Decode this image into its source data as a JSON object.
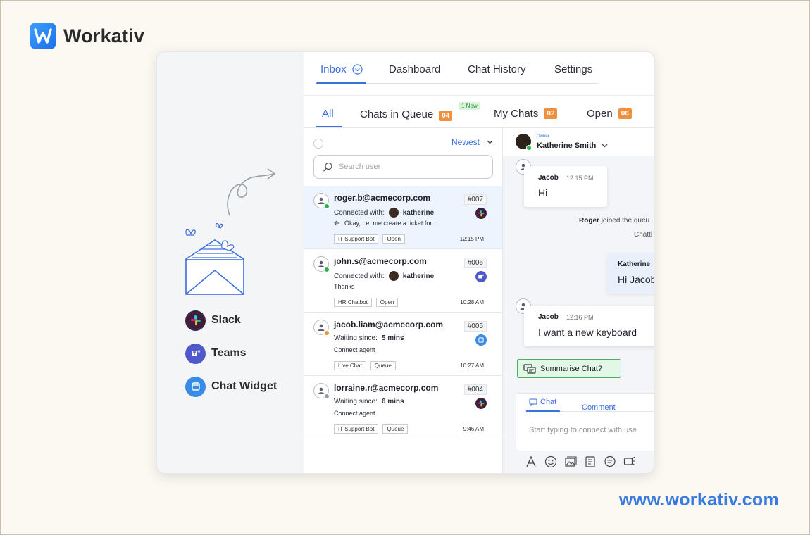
{
  "brand": {
    "name": "Workativ",
    "url": "www.workativ.com"
  },
  "channels": [
    {
      "label": "Slack",
      "icon": "slack-icon"
    },
    {
      "label": "Teams",
      "icon": "teams-icon"
    },
    {
      "label": "Chat Widget",
      "icon": "chat-widget-icon"
    }
  ],
  "nav": {
    "inbox": "Inbox",
    "dashboard": "Dashboard",
    "chat_history": "Chat History",
    "settings": "Settings"
  },
  "subtabs": {
    "all": "All",
    "queue": "Chats in Queue",
    "queue_count": "04",
    "new_badge": "1 New",
    "my_chats": "My Chats",
    "my_count": "02",
    "open": "Open",
    "open_count": "06"
  },
  "list": {
    "sort_label": "Newest",
    "search_placeholder": "Search user",
    "rows": [
      {
        "email": "roger.b@acmecorp.com",
        "id": "#007",
        "line2_label": "Connected with:",
        "agent": "katherine",
        "line3": "Okay, Let me create a ticket for...",
        "tags": [
          "IT Support Bot",
          "Open"
        ],
        "time": "12:15 PM",
        "status": "green",
        "channel": "slack-icon"
      },
      {
        "email": "john.s@acmecorp.com",
        "id": "#006",
        "line2_label": "Connected with:",
        "agent": "katherine",
        "line3": "Thanks",
        "tags": [
          "HR Chatbot",
          "Open"
        ],
        "time": "10:28 AM",
        "status": "green",
        "channel": "teams-icon"
      },
      {
        "email": "jacob.liam@acmecorp.com",
        "id": "#005",
        "line2_label": "Waiting since:",
        "wait": "5 mins",
        "line3": "Connect agent",
        "tags": [
          "Live Chat",
          "Queue"
        ],
        "time": "10:27 AM",
        "status": "orange",
        "channel": "chat-widget-icon"
      },
      {
        "email": "lorraine.r@acmecorp.com",
        "id": "#004",
        "line2_label": "Waiting since:",
        "wait": "6 mins",
        "line3": "Connect agent",
        "tags": [
          "IT Support Bot",
          "Queue"
        ],
        "time": "9:46 AM",
        "status": "gray",
        "channel": "slack-icon"
      }
    ]
  },
  "conversation": {
    "owner_label": "Owner",
    "owner_name": "Katherine Smith",
    "msg1": {
      "who": "Jacob",
      "time": "12:15 PM",
      "text": "Hi"
    },
    "sys_user": "Roger",
    "sys_text": "joined the queu",
    "sys_text2": "Chatti",
    "agent_msg": {
      "who": "Katherine",
      "text": "Hi Jacob"
    },
    "msg2": {
      "who": "Jacob",
      "time": "12:16 PM",
      "text": "I want a new keyboard"
    },
    "summarise": "Summarise Chat?",
    "composer": {
      "chat_tab": "Chat",
      "comment_tab": "Comment",
      "placeholder": "Start typing to connect with use"
    }
  }
}
